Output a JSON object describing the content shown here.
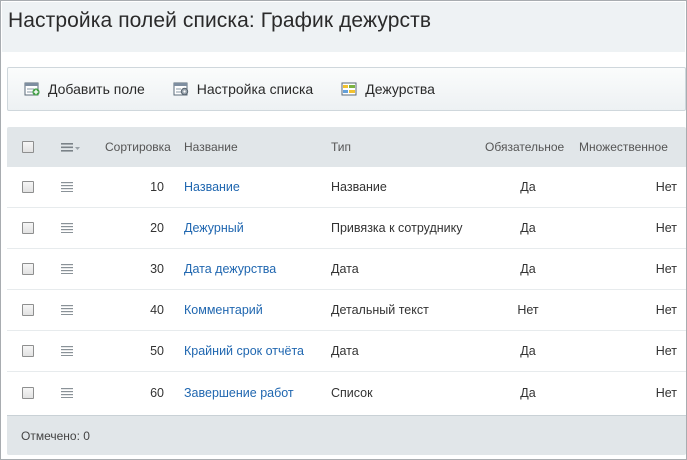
{
  "page": {
    "title": "Настройка полей списка: График дежурств"
  },
  "toolbar": {
    "buttons": [
      {
        "label": "Добавить поле",
        "icon": "add-field-icon"
      },
      {
        "label": "Настройка списка",
        "icon": "list-settings-icon"
      },
      {
        "label": "Дежурства",
        "icon": "duty-list-icon"
      }
    ]
  },
  "table": {
    "headers": {
      "sort": "Сортировка",
      "name": "Название",
      "type": "Тип",
      "required": "Обязательное",
      "multiple": "Множественное"
    },
    "rows": [
      {
        "sort": "10",
        "name": "Название",
        "type": "Название",
        "required": "Да",
        "multiple": "Нет"
      },
      {
        "sort": "20",
        "name": "Дежурный",
        "type": "Привязка к сотруднику",
        "required": "Да",
        "multiple": "Нет"
      },
      {
        "sort": "30",
        "name": "Дата дежурства",
        "type": "Дата",
        "required": "Да",
        "multiple": "Нет"
      },
      {
        "sort": "40",
        "name": "Комментарий",
        "type": "Детальный текст",
        "required": "Нет",
        "multiple": "Нет"
      },
      {
        "sort": "50",
        "name": "Крайний срок отчёта",
        "type": "Дата",
        "required": "Да",
        "multiple": "Нет"
      },
      {
        "sort": "60",
        "name": "Завершение работ",
        "type": "Список",
        "required": "Да",
        "multiple": "Нет"
      }
    ],
    "footer": "Отмечено: 0"
  },
  "colors": {
    "link": "#2067b0",
    "header_bg": "#e1e6e9",
    "title_bar_bg": "#eef2f4"
  }
}
